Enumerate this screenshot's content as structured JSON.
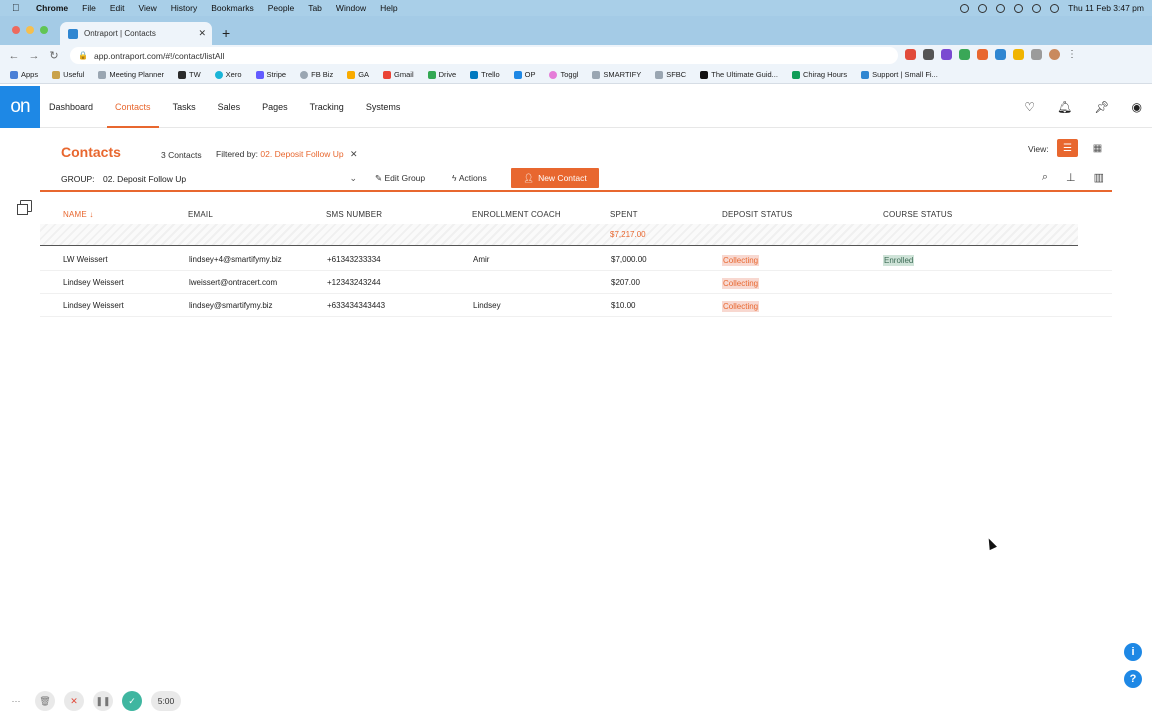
{
  "macos": {
    "menu": [
      "Chrome",
      "File",
      "Edit",
      "View",
      "History",
      "Bookmarks",
      "People",
      "Tab",
      "Window",
      "Help"
    ],
    "clock": "Thu 11 Feb  3:47 pm"
  },
  "browser": {
    "tab_title": "Ontraport | Contacts",
    "url": "app.ontraport.com/#!/contact/listAll",
    "bookmarks": [
      "Apps",
      "Useful",
      "Meeting Planner",
      "TW",
      "Xero",
      "Stripe",
      "FB Biz",
      "GA",
      "Gmail",
      "Drive",
      "Trello",
      "OP",
      "Toggl",
      "SMARTIFY",
      "SFBC",
      "The Ultimate Guid...",
      "Chirag Hours",
      "Support | Small Fi..."
    ]
  },
  "app": {
    "logo": "on",
    "nav": [
      "Dashboard",
      "Contacts",
      "Tasks",
      "Sales",
      "Pages",
      "Tracking",
      "Systems"
    ],
    "active_nav": "Contacts",
    "accent_color": "#e8672f",
    "brand_color": "#1e88e5"
  },
  "page": {
    "title": "Contacts",
    "count": "3 Contacts",
    "filter_label": "Filtered by:",
    "filter_value": "02. Deposit Follow Up",
    "view_label": "View:"
  },
  "groupbar": {
    "label": "GROUP:",
    "selected": "02. Deposit Follow Up",
    "edit_group": "Edit Group",
    "actions": "Actions",
    "new_contact": "New Contact"
  },
  "table": {
    "columns": [
      "NAME",
      "EMAIL",
      "SMS NUMBER",
      "ENROLLMENT COACH",
      "SPENT",
      "DEPOSIT STATUS",
      "COURSE STATUS"
    ],
    "sorted_column": "NAME",
    "spent_total": "$7,217.00",
    "rows": [
      {
        "name": "LW Weissert",
        "email": "lindsey+4@smartifymy.biz",
        "sms": "+61343233334",
        "coach": "Amir",
        "spent": "$7,000.00",
        "deposit": "Collecting",
        "course": "Enrolled"
      },
      {
        "name": "Lindsey Weissert",
        "email": "lweissert@ontracert.com",
        "sms": "+12343243244",
        "coach": "",
        "spent": "$207.00",
        "deposit": "Collecting",
        "course": ""
      },
      {
        "name": "Lindsey Weissert",
        "email": "lindsey@smartifymy.biz",
        "sms": "+633434343443",
        "coach": "Lindsey",
        "spent": "$10.00",
        "deposit": "Collecting",
        "course": ""
      }
    ]
  },
  "recorder": {
    "timer": "5:00"
  },
  "help": {
    "info": "i",
    "question": "?"
  }
}
